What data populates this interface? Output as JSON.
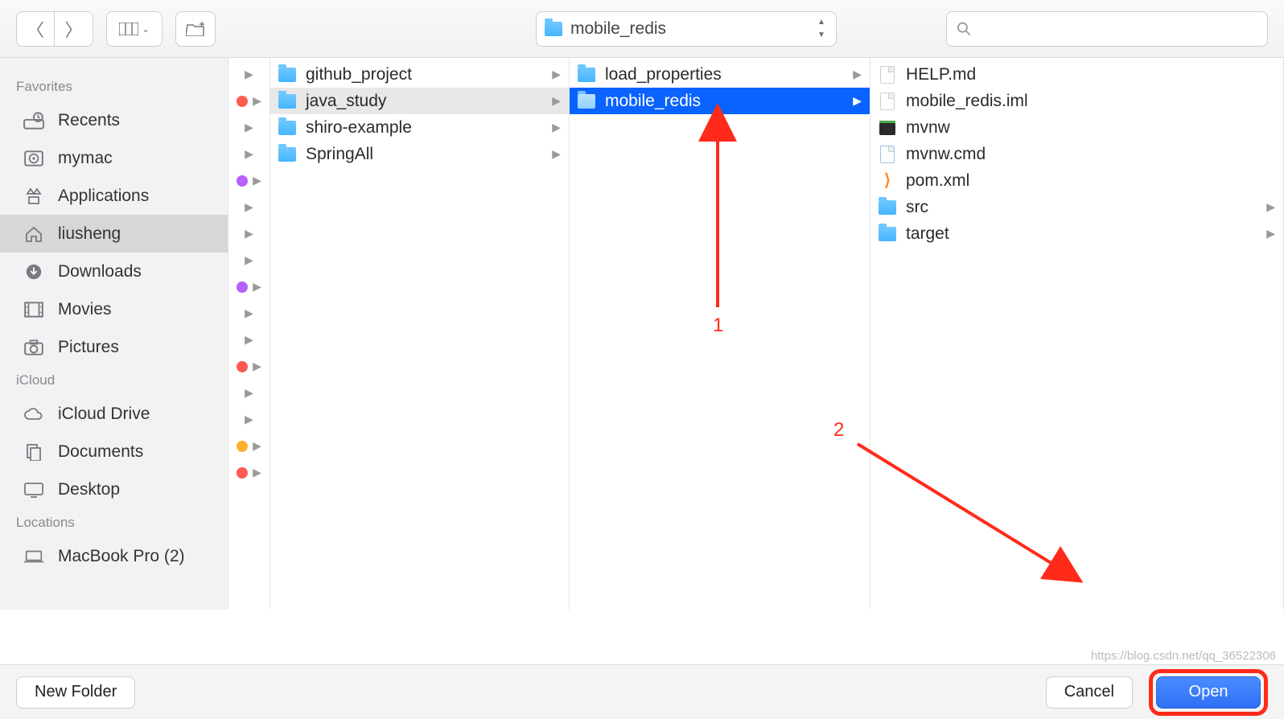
{
  "toolbar": {
    "current_folder": "mobile_redis",
    "search_placeholder": ""
  },
  "sidebar": {
    "sections": [
      {
        "heading": "Favorites",
        "items": [
          {
            "label": "Recents",
            "icon": "clock-drive"
          },
          {
            "label": "mymac",
            "icon": "disk"
          },
          {
            "label": "Applications",
            "icon": "apps"
          },
          {
            "label": "liusheng",
            "icon": "home",
            "selected": true
          },
          {
            "label": "Downloads",
            "icon": "download"
          },
          {
            "label": "Movies",
            "icon": "film"
          },
          {
            "label": "Pictures",
            "icon": "camera"
          }
        ]
      },
      {
        "heading": "iCloud",
        "items": [
          {
            "label": "iCloud Drive",
            "icon": "cloud"
          },
          {
            "label": "Documents",
            "icon": "docs"
          },
          {
            "label": "Desktop",
            "icon": "desktop"
          }
        ]
      },
      {
        "heading": "Locations",
        "items": [
          {
            "label": "MacBook Pro (2)",
            "icon": "laptop"
          }
        ]
      }
    ]
  },
  "tagstrip": [
    {
      "color": null
    },
    {
      "color": "#ff5a52"
    },
    {
      "color": null
    },
    {
      "color": null
    },
    {
      "color": "#b760ff"
    },
    {
      "color": null
    },
    {
      "color": null
    },
    {
      "color": null
    },
    {
      "color": "#b760ff"
    },
    {
      "color": null
    },
    {
      "color": null
    },
    {
      "color": "#ff5a52"
    },
    {
      "color": null
    },
    {
      "color": null
    },
    {
      "color": "#ffb02a"
    },
    {
      "color": "#ff5a52"
    }
  ],
  "columns": {
    "col1": [
      {
        "name": "github_project",
        "type": "folder",
        "hasChildren": true
      },
      {
        "name": "java_study",
        "type": "folder",
        "hasChildren": true,
        "activePath": true
      },
      {
        "name": "shiro-example",
        "type": "folder",
        "hasChildren": true
      },
      {
        "name": "SpringAll",
        "type": "folder",
        "hasChildren": true
      }
    ],
    "col2": [
      {
        "name": "load_properties",
        "type": "folder",
        "hasChildren": true
      },
      {
        "name": "mobile_redis",
        "type": "folder",
        "hasChildren": true,
        "selected": true
      }
    ],
    "col3": [
      {
        "name": "HELP.md",
        "type": "md"
      },
      {
        "name": "mobile_redis.iml",
        "type": "doc"
      },
      {
        "name": "mvnw",
        "type": "term"
      },
      {
        "name": "mvnw.cmd",
        "type": "cmd"
      },
      {
        "name": "pom.xml",
        "type": "xml"
      },
      {
        "name": "src",
        "type": "folder",
        "hasChildren": true
      },
      {
        "name": "target",
        "type": "folder",
        "hasChildren": true
      }
    ]
  },
  "buttons": {
    "new_folder": "New Folder",
    "cancel": "Cancel",
    "open": "Open"
  },
  "annotations": {
    "label1": "1",
    "label2": "2"
  },
  "watermark": "https://blog.csdn.net/qq_36522306"
}
